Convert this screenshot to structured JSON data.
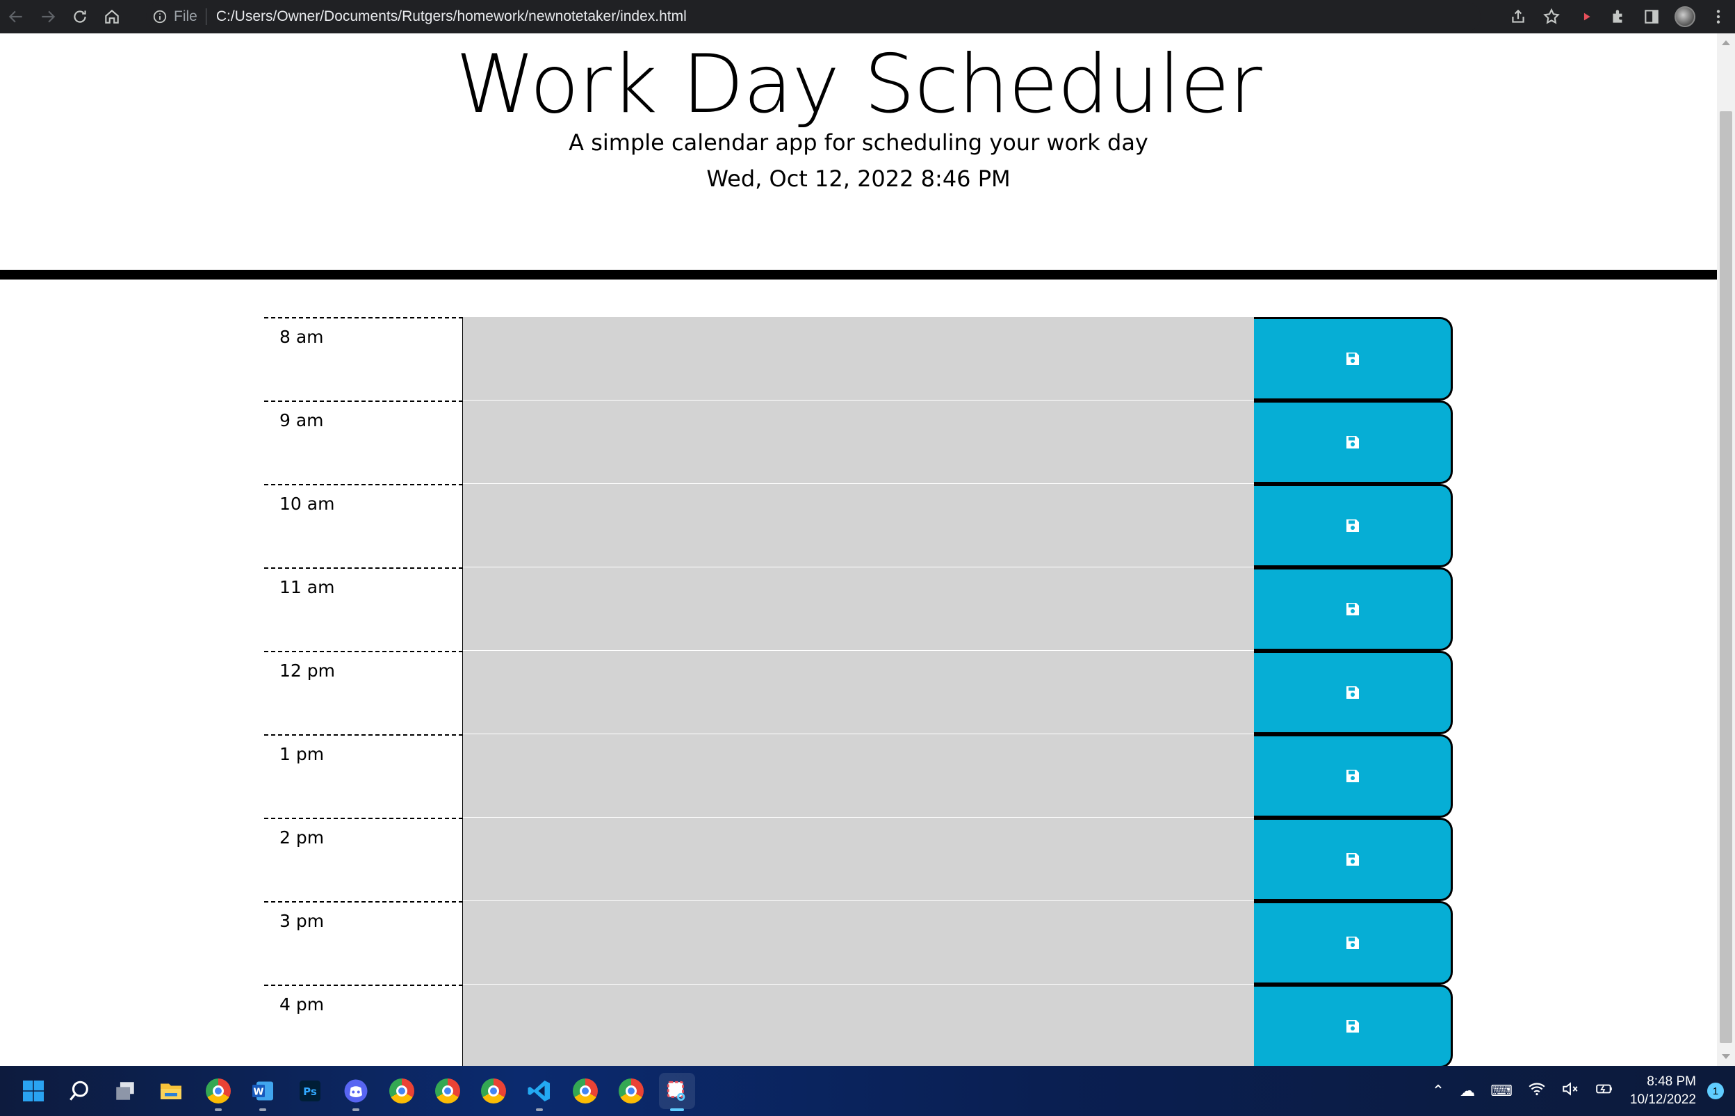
{
  "browser": {
    "scheme": "File",
    "url": "C:/Users/Owner/Documents/Rutgers/homework/newnotetaker/index.html"
  },
  "header": {
    "title": "Work Day Scheduler",
    "subtitle": "A simple calendar app for scheduling your work day",
    "current_day": "Wed, Oct 12, 2022 8:46 PM"
  },
  "schedule": {
    "rows": [
      {
        "hour": "8 am",
        "text": ""
      },
      {
        "hour": "9 am",
        "text": ""
      },
      {
        "hour": "10 am",
        "text": ""
      },
      {
        "hour": "11 am",
        "text": ""
      },
      {
        "hour": "12 pm",
        "text": ""
      },
      {
        "hour": "1 pm",
        "text": ""
      },
      {
        "hour": "2 pm",
        "text": ""
      },
      {
        "hour": "3 pm",
        "text": ""
      },
      {
        "hour": "4 pm",
        "text": ""
      }
    ],
    "save_icon": "floppy-disk-icon"
  },
  "colors": {
    "row_past": "#d3d3d3",
    "save_button": "#06aed5",
    "chrome_bar": "#202124",
    "divider": "#000000"
  },
  "taskbar": {
    "apps": [
      "windows-start",
      "search",
      "task-view",
      "file-explorer",
      "chrome",
      "word",
      "photoshop",
      "discord",
      "chrome",
      "chrome",
      "chrome",
      "vscode",
      "chrome",
      "chrome",
      "snipping-tool"
    ],
    "time": "8:48 PM",
    "date": "10/12/2022",
    "notification_count": "1"
  }
}
